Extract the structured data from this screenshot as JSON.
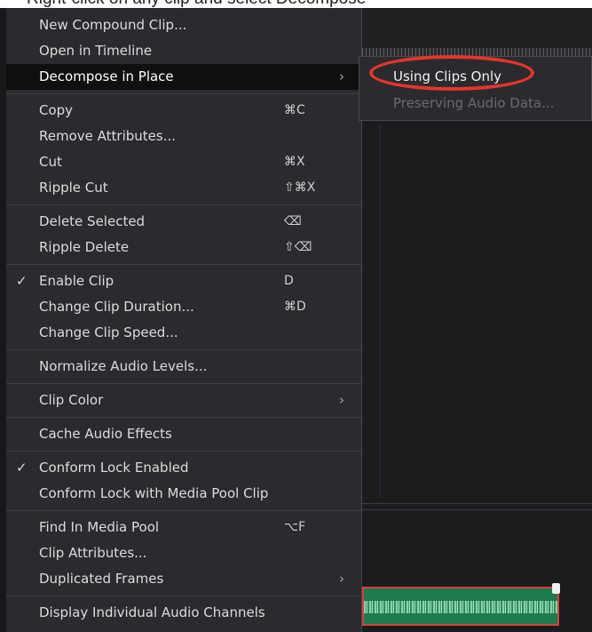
{
  "top_banner_text": "Right-click on any clip and select Decompose",
  "menu": {
    "groups": [
      [
        {
          "label": "New Compound Clip...",
          "shortcut": "",
          "checked": false,
          "submenu": false
        },
        {
          "label": "Open in Timeline",
          "shortcut": "",
          "checked": false,
          "submenu": false
        },
        {
          "label": "Decompose in Place",
          "shortcut": "",
          "checked": false,
          "submenu": true
        }
      ],
      [
        {
          "label": "Copy",
          "shortcut": "⌘C",
          "checked": false,
          "submenu": false
        },
        {
          "label": "Remove Attributes...",
          "shortcut": "",
          "checked": false,
          "submenu": false
        },
        {
          "label": "Cut",
          "shortcut": "⌘X",
          "checked": false,
          "submenu": false
        },
        {
          "label": "Ripple Cut",
          "shortcut": "⇧⌘X",
          "checked": false,
          "submenu": false
        }
      ],
      [
        {
          "label": "Delete Selected",
          "shortcut": "⌫",
          "checked": false,
          "submenu": false
        },
        {
          "label": "Ripple Delete",
          "shortcut": "⇧⌫",
          "checked": false,
          "submenu": false
        }
      ],
      [
        {
          "label": "Enable Clip",
          "shortcut": "D",
          "checked": true,
          "submenu": false
        },
        {
          "label": "Change Clip Duration...",
          "shortcut": "⌘D",
          "checked": false,
          "submenu": false
        },
        {
          "label": "Change Clip Speed...",
          "shortcut": "",
          "checked": false,
          "submenu": false
        }
      ],
      [
        {
          "label": "Normalize Audio Levels...",
          "shortcut": "",
          "checked": false,
          "submenu": false
        }
      ],
      [
        {
          "label": "Clip Color",
          "shortcut": "",
          "checked": false,
          "submenu": true
        }
      ],
      [
        {
          "label": "Cache Audio Effects",
          "shortcut": "",
          "checked": false,
          "submenu": false
        }
      ],
      [
        {
          "label": "Conform Lock Enabled",
          "shortcut": "",
          "checked": true,
          "submenu": false
        },
        {
          "label": "Conform Lock with Media Pool Clip",
          "shortcut": "",
          "checked": false,
          "submenu": false
        }
      ],
      [
        {
          "label": "Find In Media Pool",
          "shortcut": "⌥F",
          "checked": false,
          "submenu": false
        },
        {
          "label": "Clip Attributes...",
          "shortcut": "",
          "checked": false,
          "submenu": false
        },
        {
          "label": "Duplicated Frames",
          "shortcut": "",
          "checked": false,
          "submenu": true
        }
      ],
      [
        {
          "label": "Display Individual Audio Channels",
          "shortcut": "",
          "checked": false,
          "submenu": false
        }
      ]
    ],
    "highlighted_label": "Decompose in Place"
  },
  "submenu": {
    "active_label": "Using Clips Only",
    "disabled_label": "Preserving Audio Data..."
  },
  "icons": {
    "check": "✓",
    "submenu_arrow": "›"
  },
  "colors": {
    "menu_bg": "#2a2b2e",
    "highlight_bg": "#0f0f10",
    "annotation_red": "#e8352a",
    "audio_clip_green": "#1f7a4e"
  }
}
